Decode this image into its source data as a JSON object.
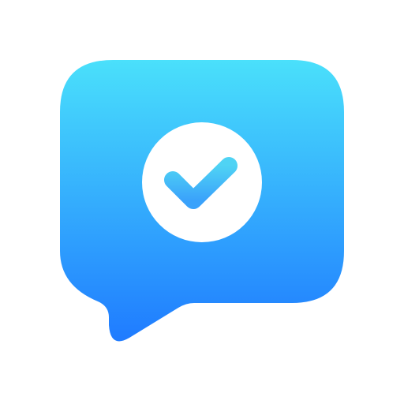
{
  "icon": {
    "name": "chat-bubble-check-icon",
    "inner_icon": "checkmark-icon",
    "colors": {
      "bubble_top": "#4AE0FB",
      "bubble_bottom": "#1F7BFF",
      "circle_fill": "#FFFFFF",
      "check_top": "#4FD3F4",
      "check_bottom": "#3AA2FB",
      "background": "#FFFFFF"
    }
  }
}
